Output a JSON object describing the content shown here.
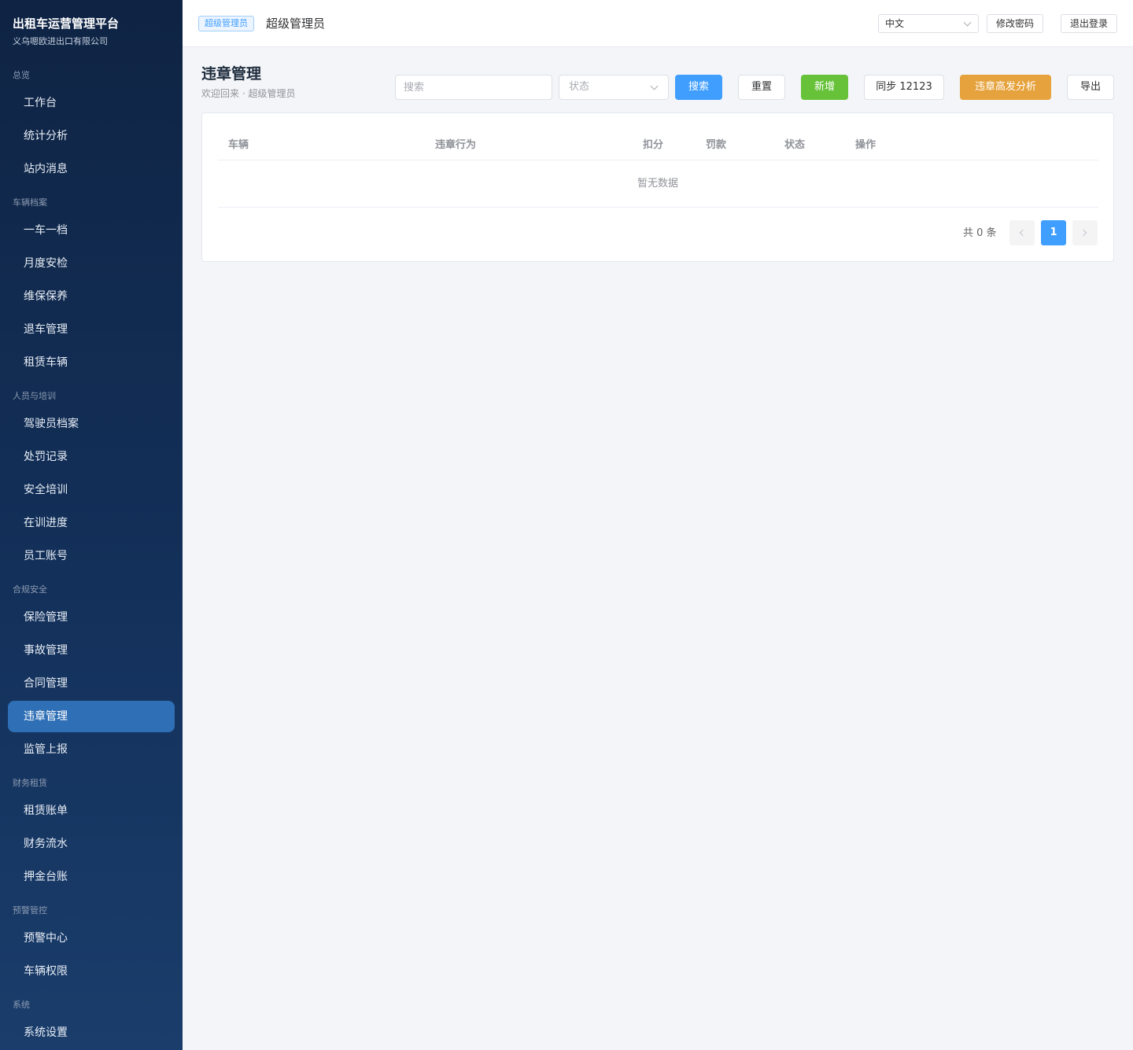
{
  "sidebar": {
    "title": "出租车运营管理平台",
    "subtitle": "义乌嗯欧进出口有限公司",
    "sections": {
      "overview": "总览",
      "vehicles": "车辆档案",
      "people": "人员与培训",
      "compliance": "合规安全",
      "finance": "财务租赁",
      "alerts": "预警管控",
      "system": "系统"
    },
    "items": {
      "workbench": "工作台",
      "stats": "统计分析",
      "messages": "站内消息",
      "onecar": "一车一档",
      "monthly": "月度安检",
      "maintenance": "维保保养",
      "return": "退车管理",
      "rental": "租赁车辆",
      "drivers": "驾驶员档案",
      "penalty": "处罚记录",
      "safety_training": "安全培训",
      "training_progress": "在训进度",
      "staff": "员工账号",
      "insurance": "保险管理",
      "accident": "事故管理",
      "contract": "合同管理",
      "violation": "违章管理",
      "report": "监管上报",
      "bills": "租赁账单",
      "flow": "财务流水",
      "deposit": "押金台账",
      "alert_center": "预警中心",
      "vehicle_perm": "车辆权限",
      "settings": "系统设置"
    },
    "active": "violation"
  },
  "header": {
    "role_tag": "超级管理员",
    "user_name": "超级管理员",
    "language": "中文",
    "change_password": "修改密码",
    "logout": "退出登录"
  },
  "page": {
    "title": "违章管理",
    "subtitle": "欢迎回来 · 超级管理员"
  },
  "toolbar": {
    "search_placeholder": "搜索",
    "status_placeholder": "状态",
    "search": "搜索",
    "reset": "重置",
    "add": "新增",
    "sync": "同步 12123",
    "analysis": "违章高发分析",
    "export": "导出"
  },
  "table": {
    "columns": {
      "vehicle": "车辆",
      "behavior": "违章行为",
      "points": "扣分",
      "fine": "罚款",
      "status": "状态",
      "actions": "操作"
    },
    "rows": [],
    "empty_text": "暂无数据"
  },
  "pagination": {
    "total": "共 0 条",
    "current": "1"
  },
  "colors": {
    "primary": "#409eff",
    "success": "#67c23a",
    "warning": "#e6a23c",
    "sidebar_active": "#2e6fb6"
  }
}
